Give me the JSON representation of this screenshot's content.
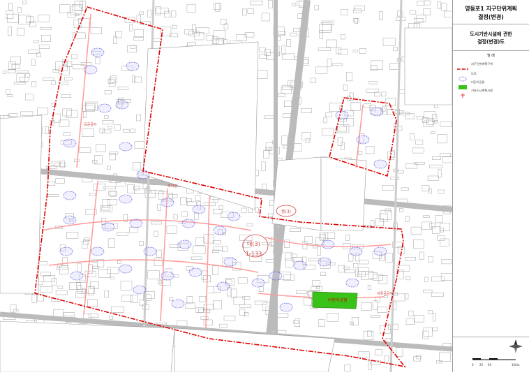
{
  "title": {
    "line1": "영등포1 지구단위계획",
    "line2": "결정(변경)"
  },
  "subtitle": {
    "line1": "도시기반시설에 관한",
    "line2": "결정(변경)도"
  },
  "legend": {
    "heading": "범  례",
    "items": [
      {
        "label": "지구단위계획구역",
        "icon": "district-boundary-line",
        "color": "#e00000"
      },
      {
        "label": "도로",
        "icon": "road-symbol",
        "color": "#3a3ad0"
      },
      {
        "label": "어린이공원",
        "icon": "park-fill",
        "color": "#39c21a"
      },
      {
        "label": "기타도시계획시설",
        "icon": "other-facility-symbol",
        "color": "#e00000"
      }
    ]
  },
  "map_labels": {
    "road_circle_a": "중(3)",
    "road_circle_b": "대(3)",
    "road_number": "1-133",
    "park": "어린이공원",
    "area_label_1": "공공공지",
    "area_label_2": "주차장",
    "area_label_3": "저류공공지"
  },
  "scale": {
    "ticks": [
      "0",
      "25",
      "50",
      "100m"
    ]
  },
  "colors": {
    "boundary": "#e00000",
    "parcel_lines": "#7a7a7a",
    "road_lines": "#ff9a9a",
    "park": "#39c21a",
    "road_symbol": "#3a3ad0"
  }
}
